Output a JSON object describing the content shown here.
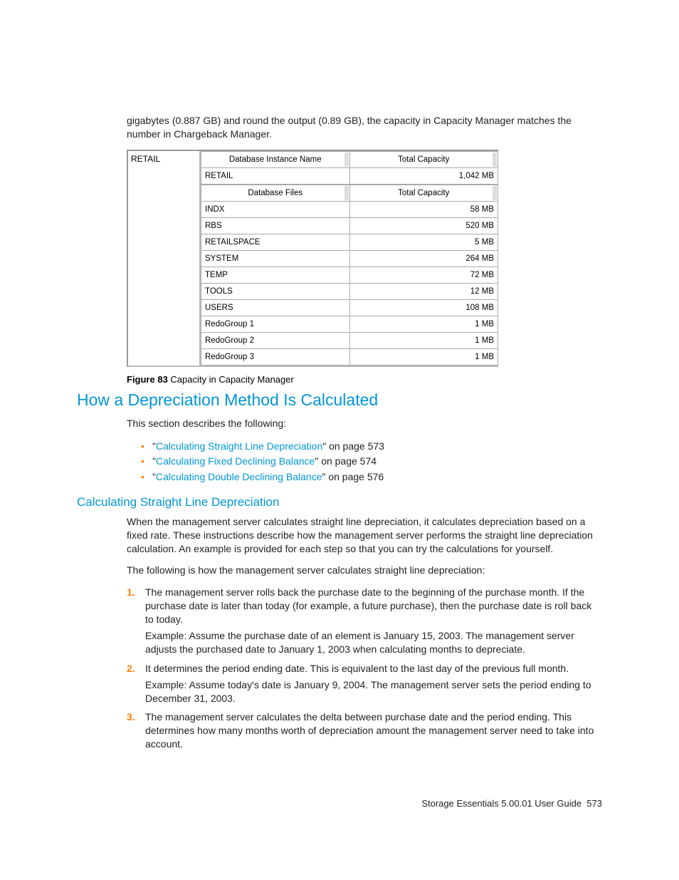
{
  "intro_para": "gigabytes (0.887 GB) and round the output (0.89 GB), the capacity in Capacity Manager matches the number in Chargeback Manager.",
  "figure": {
    "left_label": "RETAIL",
    "table1": {
      "headers": [
        "Database Instance Name",
        "Total Capacity"
      ],
      "rows": [
        {
          "name": "RETAIL",
          "value": "1,042 MB"
        }
      ]
    },
    "table2": {
      "headers": [
        "Database Files",
        "Total Capacity"
      ],
      "rows": [
        {
          "name": "INDX",
          "value": "58 MB"
        },
        {
          "name": "RBS",
          "value": "520 MB"
        },
        {
          "name": "RETAILSPACE",
          "value": "5 MB"
        },
        {
          "name": "SYSTEM",
          "value": "264 MB"
        },
        {
          "name": "TEMP",
          "value": "72 MB"
        },
        {
          "name": "TOOLS",
          "value": "12 MB"
        },
        {
          "name": "USERS",
          "value": "108 MB"
        },
        {
          "name": "RedoGroup 1",
          "value": "1 MB"
        },
        {
          "name": "RedoGroup 2",
          "value": "1 MB"
        },
        {
          "name": "RedoGroup 3",
          "value": "1 MB"
        }
      ]
    },
    "caption_label": "Figure 83",
    "caption_text": " Capacity in Capacity Manager"
  },
  "heading1": "How a Depreciation Method Is Calculated",
  "section_intro": "This section describes the following:",
  "bullets": [
    {
      "pre": "\"",
      "link": "Calculating Straight Line Depreciation",
      "post": "\" on page 573"
    },
    {
      "pre": "\"",
      "link": "Calculating Fixed Declining Balance",
      "post": "\" on page 574"
    },
    {
      "pre": "\"",
      "link": "Calculating Double Declining Balance",
      "post": "\" on page 576"
    }
  ],
  "heading2": "Calculating Straight Line Depreciation",
  "para1": "When the management server calculates straight line depreciation, it calculates depreciation based on a fixed rate. These instructions describe how the management server performs the straight line depreciation calculation. An example is provided for each step so that you can try the calculations for yourself.",
  "para2": "The following is how the management server calculates straight line depreciation:",
  "steps": [
    {
      "main": "The management server rolls back the purchase date to the beginning of the purchase month. If the purchase date is later than today (for example, a future purchase), then the purchase date is roll back to today.",
      "example": "Example: Assume the purchase date of an element is January 15, 2003. The management server adjusts the purchased date to January 1, 2003 when calculating months to depreciate."
    },
    {
      "main": "It determines the period ending date. This is equivalent to the last day of the previous full month.",
      "example": "Example: Assume today's date is January 9, 2004. The management server sets the period ending to December 31, 2003."
    },
    {
      "main": "The management server calculates the delta between purchase date and the period ending. This determines how many months worth of depreciation amount the management server need to take into account.",
      "example": ""
    }
  ],
  "footer": {
    "text": "Storage Essentials 5.00.01 User Guide",
    "page": "573"
  }
}
